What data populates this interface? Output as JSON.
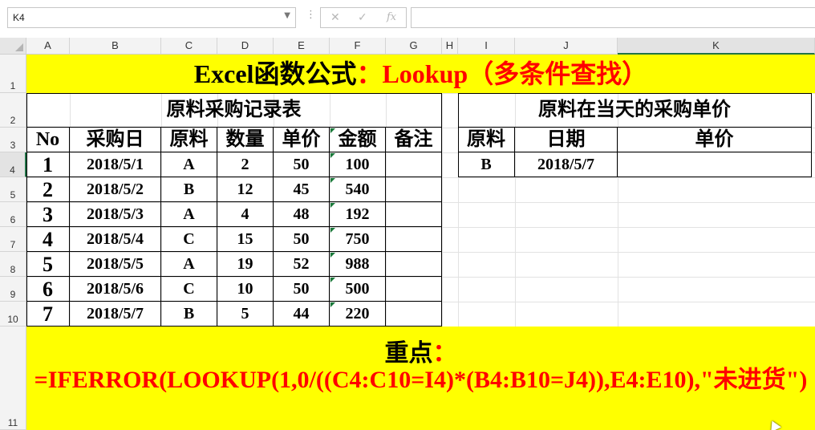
{
  "formula_bar": {
    "name_box": "K4",
    "cancel_icon": "✕",
    "enter_icon": "✓",
    "fx_label": "fx",
    "formula": ""
  },
  "columns": [
    "A",
    "B",
    "C",
    "D",
    "E",
    "F",
    "G",
    "H",
    "I",
    "J",
    "K"
  ],
  "rows": [
    "1",
    "2",
    "3",
    "4",
    "5",
    "6",
    "7",
    "8",
    "9",
    "10",
    "11"
  ],
  "title": {
    "part1": "Excel函数公式",
    "part2": "：Lookup（多条件查找）"
  },
  "purchase_table": {
    "caption": "原料采购记录表",
    "headers": [
      "No",
      "采购日",
      "原料",
      "数量",
      "单价",
      "金额",
      "备注"
    ],
    "rows": [
      [
        "1",
        "2018/5/1",
        "A",
        "2",
        "50",
        "100",
        ""
      ],
      [
        "2",
        "2018/5/2",
        "B",
        "12",
        "45",
        "540",
        ""
      ],
      [
        "3",
        "2018/5/3",
        "A",
        "4",
        "48",
        "192",
        ""
      ],
      [
        "4",
        "2018/5/4",
        "C",
        "15",
        "50",
        "750",
        ""
      ],
      [
        "5",
        "2018/5/5",
        "A",
        "19",
        "52",
        "988",
        ""
      ],
      [
        "6",
        "2018/5/6",
        "C",
        "10",
        "50",
        "500",
        ""
      ],
      [
        "7",
        "2018/5/7",
        "B",
        "5",
        "44",
        "220",
        ""
      ]
    ]
  },
  "lookup_table": {
    "caption": "原料在当天的采购单价",
    "headers": [
      "原料",
      "日期",
      "单价"
    ],
    "row": [
      "B",
      "2018/5/7",
      ""
    ]
  },
  "note": {
    "heading": "重点",
    "colon": "：",
    "formula": "=IFERROR(LOOKUP(1,0/((C4:C10=I4)*(B4:B10=J4)),E4:E10),\"未进货\")"
  },
  "colors": {
    "highlight": "#ffff00",
    "accent_red": "#ff0000"
  }
}
